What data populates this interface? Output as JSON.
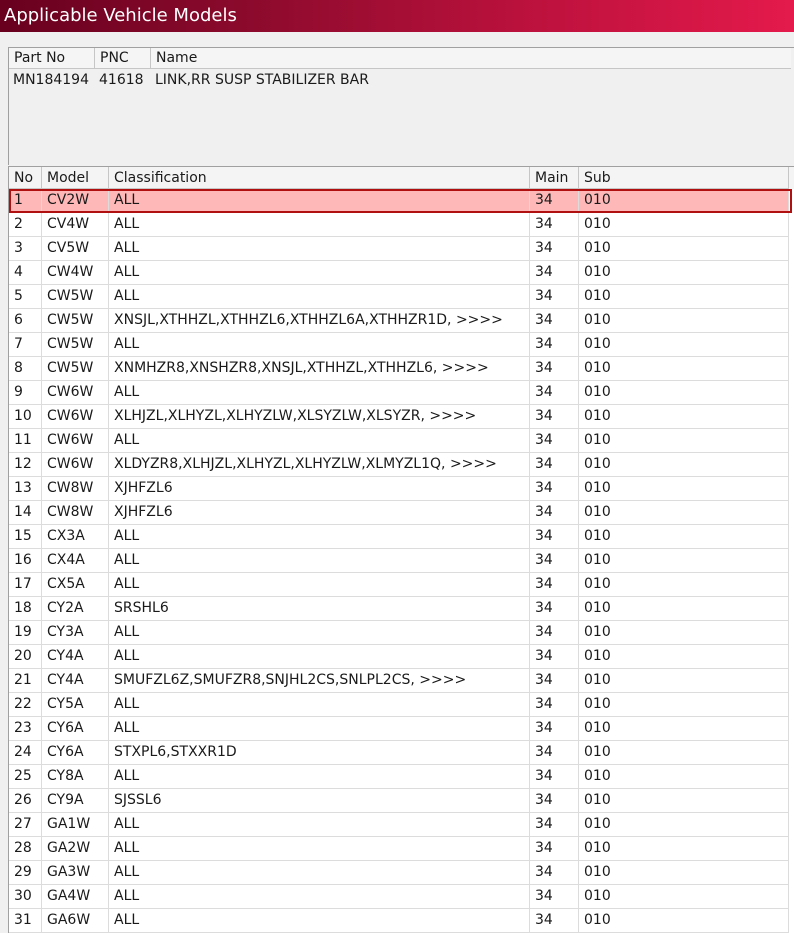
{
  "window": {
    "title": "Applicable Vehicle Models"
  },
  "part": {
    "headers": {
      "part_no": "Part No",
      "pnc": "PNC",
      "name": "Name"
    },
    "row": {
      "part_no": "MN184194",
      "pnc": "41618",
      "name": "LINK,RR SUSP STABILIZER BAR"
    }
  },
  "grid": {
    "headers": {
      "no": "No",
      "model": "Model",
      "classification": "Classification",
      "main": "Main",
      "sub": "Sub"
    },
    "selected_index": 0,
    "rows": [
      {
        "no": "1",
        "model": "CV2W",
        "classification": "ALL",
        "main": "34",
        "sub": "010"
      },
      {
        "no": "2",
        "model": "CV4W",
        "classification": "ALL",
        "main": "34",
        "sub": "010"
      },
      {
        "no": "3",
        "model": "CV5W",
        "classification": "ALL",
        "main": "34",
        "sub": "010"
      },
      {
        "no": "4",
        "model": "CW4W",
        "classification": "ALL",
        "main": "34",
        "sub": "010"
      },
      {
        "no": "5",
        "model": "CW5W",
        "classification": "ALL",
        "main": "34",
        "sub": "010"
      },
      {
        "no": "6",
        "model": "CW5W",
        "classification": "XNSJL,XTHHZL,XTHHZL6,XTHHZL6A,XTHHZR1D,  >>>>",
        "main": "34",
        "sub": "010"
      },
      {
        "no": "7",
        "model": "CW5W",
        "classification": "ALL",
        "main": "34",
        "sub": "010"
      },
      {
        "no": "8",
        "model": "CW5W",
        "classification": "XNMHZR8,XNSHZR8,XNSJL,XTHHZL,XTHHZL6,  >>>>",
        "main": "34",
        "sub": "010"
      },
      {
        "no": "9",
        "model": "CW6W",
        "classification": "ALL",
        "main": "34",
        "sub": "010"
      },
      {
        "no": "10",
        "model": "CW6W",
        "classification": "XLHJZL,XLHYZL,XLHYZLW,XLSYZLW,XLSYZR,  >>>>",
        "main": "34",
        "sub": "010"
      },
      {
        "no": "11",
        "model": "CW6W",
        "classification": "ALL",
        "main": "34",
        "sub": "010"
      },
      {
        "no": "12",
        "model": "CW6W",
        "classification": "XLDYZR8,XLHJZL,XLHYZL,XLHYZLW,XLMYZL1Q,  >>>>",
        "main": "34",
        "sub": "010"
      },
      {
        "no": "13",
        "model": "CW8W",
        "classification": "XJHFZL6",
        "main": "34",
        "sub": "010"
      },
      {
        "no": "14",
        "model": "CW8W",
        "classification": "XJHFZL6",
        "main": "34",
        "sub": "010"
      },
      {
        "no": "15",
        "model": "CX3A",
        "classification": "ALL",
        "main": "34",
        "sub": "010"
      },
      {
        "no": "16",
        "model": "CX4A",
        "classification": "ALL",
        "main": "34",
        "sub": "010"
      },
      {
        "no": "17",
        "model": "CX5A",
        "classification": "ALL",
        "main": "34",
        "sub": "010"
      },
      {
        "no": "18",
        "model": "CY2A",
        "classification": "SRSHL6",
        "main": "34",
        "sub": "010"
      },
      {
        "no": "19",
        "model": "CY3A",
        "classification": "ALL",
        "main": "34",
        "sub": "010"
      },
      {
        "no": "20",
        "model": "CY4A",
        "classification": "ALL",
        "main": "34",
        "sub": "010"
      },
      {
        "no": "21",
        "model": "CY4A",
        "classification": "SMUFZL6Z,SMUFZR8,SNJHL2CS,SNLPL2CS,  >>>>",
        "main": "34",
        "sub": "010"
      },
      {
        "no": "22",
        "model": "CY5A",
        "classification": "ALL",
        "main": "34",
        "sub": "010"
      },
      {
        "no": "23",
        "model": "CY6A",
        "classification": "ALL",
        "main": "34",
        "sub": "010"
      },
      {
        "no": "24",
        "model": "CY6A",
        "classification": "STXPL6,STXXR1D",
        "main": "34",
        "sub": "010"
      },
      {
        "no": "25",
        "model": "CY8A",
        "classification": "ALL",
        "main": "34",
        "sub": "010"
      },
      {
        "no": "26",
        "model": "CY9A",
        "classification": "SJSSL6",
        "main": "34",
        "sub": "010"
      },
      {
        "no": "27",
        "model": "GA1W",
        "classification": "ALL",
        "main": "34",
        "sub": "010"
      },
      {
        "no": "28",
        "model": "GA2W",
        "classification": "ALL",
        "main": "34",
        "sub": "010"
      },
      {
        "no": "29",
        "model": "GA3W",
        "classification": "ALL",
        "main": "34",
        "sub": "010"
      },
      {
        "no": "30",
        "model": "GA4W",
        "classification": "ALL",
        "main": "34",
        "sub": "010"
      },
      {
        "no": "31",
        "model": "GA6W",
        "classification": "ALL",
        "main": "34",
        "sub": "010"
      }
    ]
  }
}
